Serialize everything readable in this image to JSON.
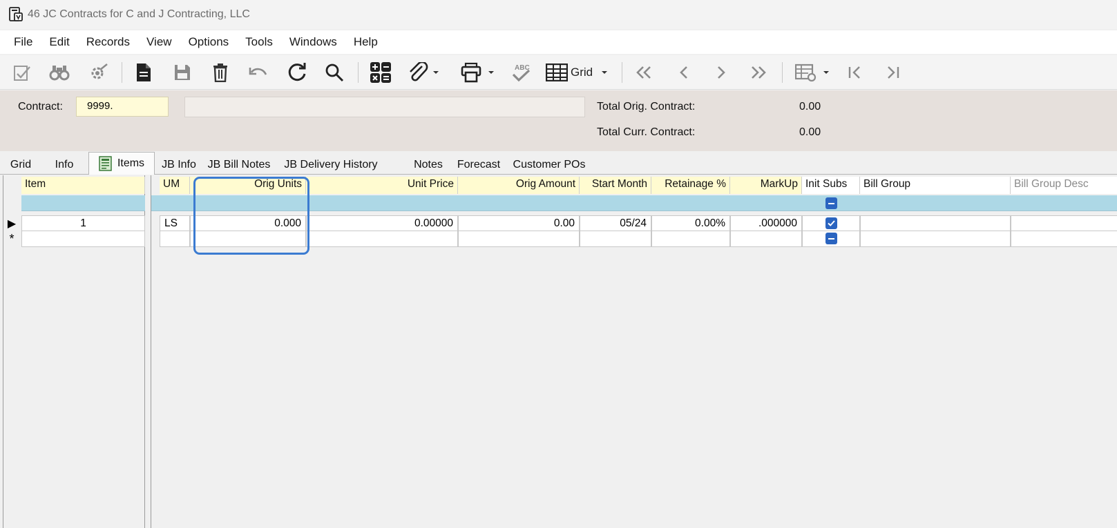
{
  "window": {
    "title": "46 JC Contracts for C and J Contracting, LLC",
    "app_icon": "form-icon"
  },
  "menu": {
    "items": [
      "File",
      "Edit",
      "Records",
      "View",
      "Options",
      "Tools",
      "Windows",
      "Help"
    ]
  },
  "toolbar": {
    "grid_label": "Grid",
    "icons": [
      "validate-icon",
      "find-icon",
      "settings-icon",
      "new-record-icon",
      "save-icon",
      "delete-icon",
      "undo-icon",
      "refresh-icon",
      "search-icon",
      "calculator-icon",
      "attachment-icon",
      "print-icon",
      "spellcheck-icon",
      "grid-view-icon",
      "first-page-icon",
      "previous-icon",
      "next-icon",
      "last-page-icon",
      "grid-settings-icon",
      "first-record-icon",
      "last-record-icon"
    ]
  },
  "header": {
    "contract_label": "Contract:",
    "contract_value": "9999.",
    "description_value": "",
    "total_orig_label": "Total Orig. Contract:",
    "total_orig_value": "0.00",
    "total_curr_label": "Total Curr. Contract:",
    "total_curr_value": "0.00"
  },
  "tabs": [
    "Grid",
    "Info",
    "Items",
    "JB Info",
    "JB Bill Notes",
    "JB Delivery History",
    "Notes",
    "Forecast",
    "Customer POs"
  ],
  "active_tab": "Items",
  "grid": {
    "left_columns": [
      "Item"
    ],
    "right_columns": [
      "UM",
      "Orig Units",
      "Unit Price",
      "Orig Amount",
      "Start Month",
      "Retainage %",
      "MarkUp",
      "Init Subs",
      "Bill Group",
      "Bill Group Desc"
    ],
    "rows": [
      {
        "item": "1",
        "um": "LS",
        "orig_units": "0.000",
        "unit_price": "0.00000",
        "orig_amount": "0.00",
        "start_month": "05/24",
        "retainage": "0.00%",
        "markup": ".000000",
        "init_subs": true,
        "bill_group": "",
        "bill_group_desc": ""
      }
    ],
    "new_row_marker": "*",
    "current_row_marker": "▶"
  },
  "colors": {
    "required_header": "#fffbd0",
    "filter_row": "#add8e6",
    "highlight": "#3b7bd1",
    "header_panel": "#e6e0dc"
  }
}
